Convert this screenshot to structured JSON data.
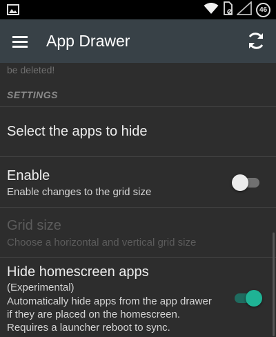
{
  "status_bar": {
    "battery_level": "46",
    "icons": [
      "image-icon",
      "wifi-icon",
      "sim-icon",
      "signal-icon"
    ]
  },
  "app_bar": {
    "title": "App Drawer",
    "menu_icon": "hamburger-menu-icon",
    "refresh_icon": "refresh-icon",
    "background": "#384147"
  },
  "content": {
    "cut_text": "be deleted!",
    "section_header": "SETTINGS",
    "items": [
      {
        "title": "Select the apps to hide"
      },
      {
        "title": "Enable",
        "subtitle": "Enable changes to the grid size",
        "toggle": "off"
      },
      {
        "title": "Grid size",
        "subtitle": "Choose a horizontal and vertical grid size",
        "disabled": true
      },
      {
        "title": "Hide homescreen apps",
        "subtitle_lines": [
          "(Experimental)",
          "Automatically hide apps from the app drawer",
          "if they are placed on the homescreen.",
          "Requires a launcher reboot to sync."
        ],
        "toggle": "on"
      }
    ]
  },
  "colors": {
    "accent": "#1fb395",
    "background": "#2d2d2d"
  }
}
